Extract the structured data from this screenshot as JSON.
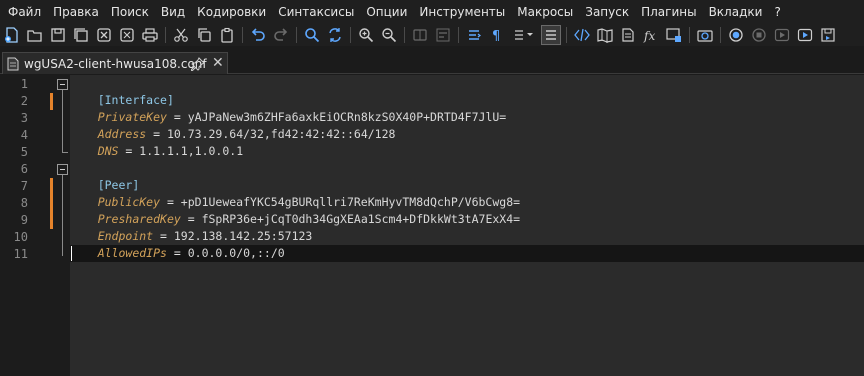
{
  "menu": [
    "Файл",
    "Правка",
    "Поиск",
    "Вид",
    "Кодировки",
    "Синтаксисы",
    "Опции",
    "Инструменты",
    "Макросы",
    "Запуск",
    "Плагины",
    "Вкладки",
    "?"
  ],
  "toolbar": {
    "icons": [
      "new-file-icon",
      "open-file-icon",
      "save-icon",
      "save-all-icon",
      "close-icon",
      "close-all-icon",
      "print-icon",
      "cut-icon",
      "copy-icon",
      "paste-icon",
      "undo-icon",
      "redo-icon",
      "find-icon",
      "replace-icon",
      "zoom-in-icon",
      "zoom-out-icon",
      "sync-scroll-icon",
      "word-wrap-icon",
      "show-all-chars-icon",
      "indent-guide-icon",
      "udl-icon",
      "document-map-icon",
      "function-list-icon",
      "folder-as-workspace-icon",
      "monitoring-icon",
      "record-macro-icon",
      "stop-macro-icon",
      "play-macro-icon",
      "run-macro-multiple-icon",
      "save-macro-icon"
    ]
  },
  "tab": {
    "label": "wgUSA2-client-hwusa108.conf",
    "close": "✕"
  },
  "editor": {
    "line_numbers": [
      "1",
      "2",
      "3",
      "4",
      "5",
      "6",
      "7",
      "8",
      "9",
      "10",
      "11"
    ],
    "lines": [
      {
        "section": "[Interface]"
      },
      {
        "key": "PrivateKey",
        "eq": " = ",
        "value": "yAJPaNew3m6ZHFa6axkEiOCRn8kzS0X40P+DRTD4F7JlU="
      },
      {
        "key": "Address",
        "eq": " = ",
        "value": "10.73.29.64/32,fd42:42:42::64/128"
      },
      {
        "key": "DNS",
        "eq": " = ",
        "value": "1.1.1.1,1.0.0.1"
      },
      {},
      {
        "section": "[Peer]"
      },
      {
        "key": "PublicKey",
        "eq": " = ",
        "value": "+pD1UeweafYKC54gBURqllri7ReKmHyvTM8dQchP/V6bCwg8="
      },
      {
        "key": "PresharedKey",
        "eq": " = ",
        "value": "fSpRP36e+jCqT0dh34GgXEAa1Scm4+DfDkkWt3tA7ExX4="
      },
      {
        "key": "Endpoint",
        "eq": " = ",
        "value": "192.138.142.25:57123"
      },
      {
        "key": "AllowedIPs",
        "eq": " = ",
        "value": "0.0.0.0/0,::/0"
      },
      {}
    ]
  },
  "colors": {
    "section": "#8ec7e6",
    "key": "#d2a25a",
    "change_marker": "#e5832b",
    "editor_bg": "#2b2b2b"
  }
}
